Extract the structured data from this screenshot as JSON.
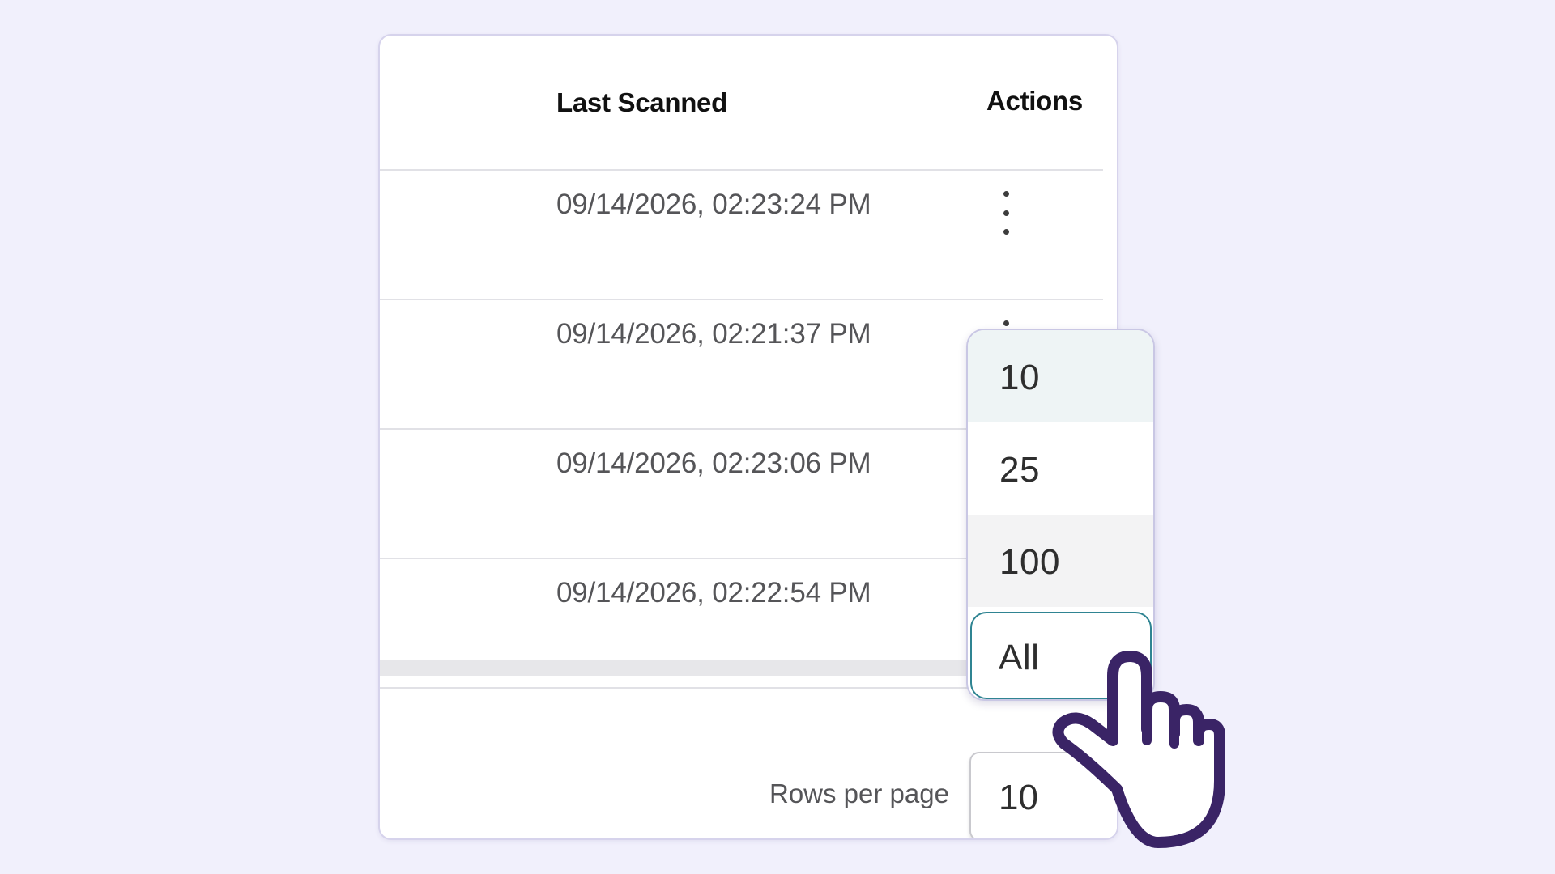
{
  "table": {
    "columns": {
      "last_scanned": "Last Scanned",
      "actions": "Actions"
    },
    "rows": [
      {
        "last_scanned": "09/14/2026, 02:23:24 PM"
      },
      {
        "last_scanned": "09/14/2026, 02:21:37 PM"
      },
      {
        "last_scanned": "09/14/2026, 02:23:06 PM"
      },
      {
        "last_scanned": "09/14/2026, 02:22:54 PM"
      }
    ]
  },
  "pagination": {
    "rows_per_page_label": "Rows per page",
    "rows_per_page_value": "10",
    "options": [
      "10",
      "25",
      "100",
      "All"
    ],
    "highlighted_option": "All"
  },
  "colors": {
    "background": "#f1f0fc",
    "focus_outline": "#2f8492",
    "cursor_outline": "#3a2466"
  },
  "icons": {
    "row_actions": "more-vertical-icon",
    "cursor": "hand-pointer-icon"
  }
}
